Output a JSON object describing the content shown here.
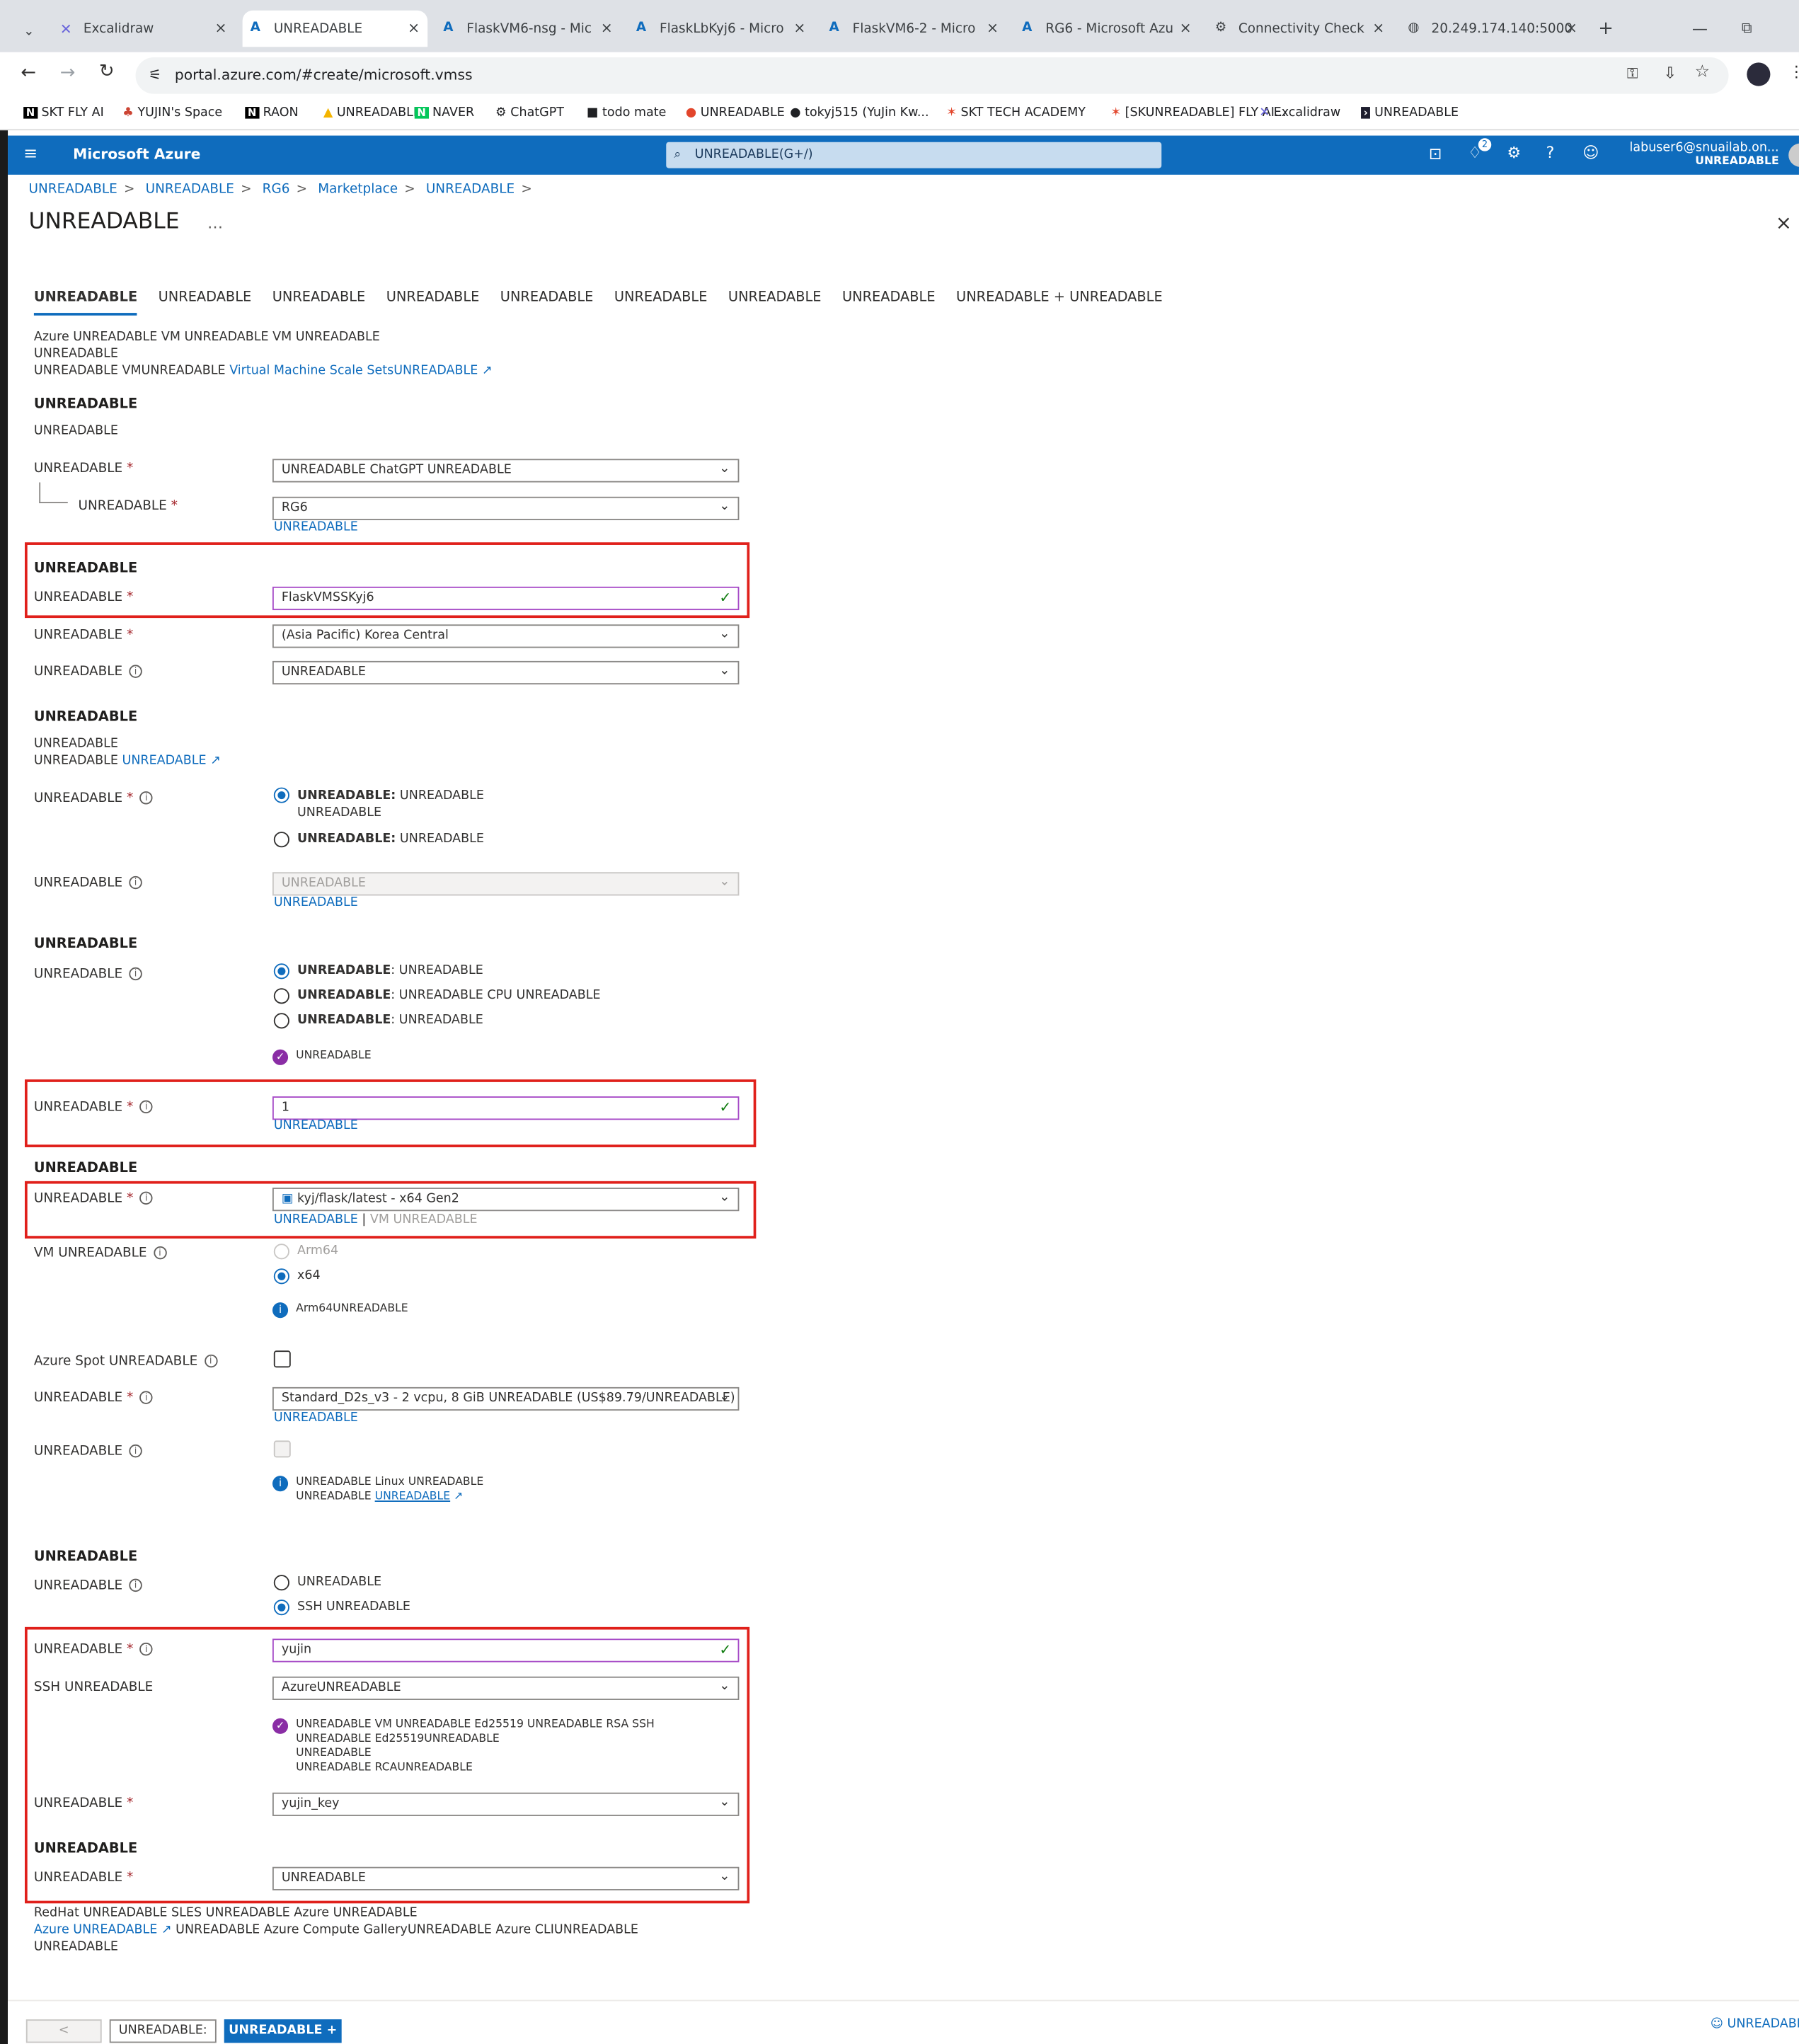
{
  "browser": {
    "tabs": [
      {
        "label": "Excalidraw",
        "close": "×"
      },
      {
        "label": "UNREADABLE",
        "close": "×"
      },
      {
        "label": "FlaskVM6-nsg - Mic",
        "close": "×"
      },
      {
        "label": "FlaskLbKyj6 - Micro",
        "close": "×"
      },
      {
        "label": "FlaskVM6-2 - Micro",
        "close": "×"
      },
      {
        "label": "RG6 - Microsoft Azu",
        "close": "×"
      },
      {
        "label": "Connectivity Check",
        "close": "×"
      },
      {
        "label": "20.249.174.140:5000",
        "close": "×"
      }
    ],
    "url": "portal.azure.com/#create/microsoft.vmss",
    "bookmarks": [
      "SKT FLY AI",
      "YUJIN's Space",
      "RAON",
      "UNREADABLE",
      "NAVER",
      "ChatGPT",
      "todo mate",
      "UNREADABLE",
      "tokyj515 (YuJin Kw...",
      "SKT TECH ACADEMY",
      "[SKUNREADABLE] FLY AI...",
      "Excalidraw",
      "UNREADABLE"
    ]
  },
  "azure": {
    "brand": "Microsoft Azure",
    "search_placeholder": "UNREADABLE(G+/)",
    "user_email": "labuser6@snuailab.on...",
    "user_org": "UNREADABLE",
    "notification_count": "2"
  },
  "breadcrumb": [
    "UNREADABLE",
    "UNREADABLE",
    "RG6",
    "Marketplace",
    "UNREADABLE"
  ],
  "page_title": "UNREADABLE",
  "tabs": [
    "UNREADABLE",
    "UNREADABLE",
    "UNREADABLE",
    "UNREADABLE",
    "UNREADABLE",
    "UNREADABLE",
    "UNREADABLE",
    "UNREADABLE",
    "UNREADABLE + UNREADABLE"
  ],
  "intro": {
    "line1": "Azure UNREADABLE VM UNREADABLE VM UNREADABLE",
    "line2": "UNREADABLE",
    "line3_pre": "UNREADABLE VMUNREADABLE",
    "line3_link": "Virtual Machine Scale SetsUNREADABLE"
  },
  "project": {
    "heading": "UNREADABLE",
    "desc": "UNREADABLE",
    "subscription_label": "UNREADABLE",
    "subscription_value": "UNREADABLE ChatGPT UNREADABLE",
    "rg_label": "UNREADABLE",
    "rg_value": "RG6",
    "rg_new": "UNREADABLE"
  },
  "scaleset": {
    "heading": "UNREADABLE",
    "name_label": "UNREADABLE",
    "name_value": "FlaskVMSSKyj6",
    "region_label": "UNREADABLE",
    "region_value": "(Asia Pacific) Korea Central",
    "az_label": "UNREADABLE",
    "az_value": "UNREADABLE"
  },
  "orchestration": {
    "heading": "UNREADABLE",
    "desc1": "UNREADABLE",
    "desc2_pre": "UNREADABLE",
    "desc2_link": "UNREADABLE",
    "mode_label": "UNREADABLE",
    "flex_bold": "UNREADABLE:",
    "flex_text": "UNREADABLE",
    "flex_text2": "UNREADABLE",
    "uniform_bold": "UNREADABLE:",
    "uniform_text": "UNREADABLE",
    "security_label": "UNREADABLE",
    "security_value": "UNREADABLE",
    "security_link": "UNREADABLE"
  },
  "scaling": {
    "heading": "UNREADABLE",
    "mode_label": "UNREADABLE",
    "opt1_bold": "UNREADABLE",
    "opt1_text": ": UNREADABLE",
    "opt2_bold": "UNREADABLE",
    "opt2_text": ": UNREADABLE CPU UNREADABLE",
    "opt3_bold": "UNREADABLE",
    "opt3_text": ": UNREADABLE",
    "zone_note": "UNREADABLE",
    "count_label": "UNREADABLE",
    "count_value": "1",
    "count_link": "UNREADABLE"
  },
  "instance": {
    "heading": "UNREADABLE",
    "image_label": "UNREADABLE",
    "image_value": "kyj/flask/latest - x64 Gen2",
    "image_link1": "UNREADABLE",
    "image_sep": " | ",
    "image_link2": "VM UNREADABLE",
    "arch_label": "VM UNREADABLE",
    "arch_arm": "Arm64",
    "arch_x64": "x64",
    "arch_note": "Arm64UNREADABLE",
    "spot_label": "Azure Spot UNREADABLE",
    "size_label": "UNREADABLE",
    "size_value": "Standard_D2s_v3 - 2 vcpu, 8 GiB UNREADABLE (US$89.79/UNREADABLE)",
    "size_link": "UNREADABLE",
    "hib_label": "UNREADABLE",
    "hib_note1": "UNREADABLE Linux UNREADABLE",
    "hib_note2_pre": "UNREADABLE",
    "hib_note2_link": "UNREADABLE"
  },
  "admin": {
    "heading": "UNREADABLE",
    "auth_label": "UNREADABLE",
    "auth_pw": "UNREADABLE",
    "auth_ssh": "SSH UNREADABLE",
    "user_label": "UNREADABLE",
    "user_value": "yujin",
    "ssh_source_label": "SSH UNREADABLE",
    "ssh_source_value": "AzureUNREADABLE",
    "ssh_note1": "UNREADABLE VM UNREADABLE Ed25519 UNREADABLE RSA SSH UNREADABLE Ed25519UNREADABLE",
    "ssh_note2": "UNREADABLE",
    "ssh_note3": "UNREADABLE RCAUNREADABLE",
    "stored_key_label": "UNREADABLE",
    "stored_key_value": "yujin_key"
  },
  "licensing": {
    "heading": "UNREADABLE",
    "type_label": "UNREADABLE",
    "type_value": "UNREADABLE",
    "desc1": "RedHat UNREADABLE SLES UNREADABLE Azure UNREADABLE",
    "desc2_link": "Azure UNREADABLE",
    "desc2_rest": " UNREADABLE Azure Compute GalleryUNREADABLE Azure CLIUNREADABLE",
    "desc3": "UNREADABLE"
  },
  "footer": {
    "prev": "< UNREADABLE",
    "next": "UNREADABLE: UNREADABLE >",
    "review": "UNREADABLE + UNREADABLE",
    "feedback": "UNREADABLE"
  }
}
